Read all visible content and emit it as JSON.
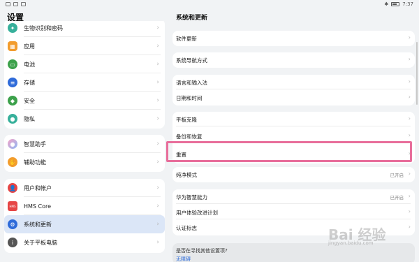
{
  "status_bar": {
    "time": "7:37"
  },
  "left": {
    "title": "设置",
    "items": [
      {
        "label": "生物识别和密码",
        "icon": "fingerprint-icon",
        "color": "#37b09b"
      },
      {
        "label": "应用",
        "icon": "apps-icon",
        "color": "#f29c2d"
      },
      {
        "label": "电池",
        "icon": "battery-icon",
        "color": "#3ca14b"
      },
      {
        "label": "存储",
        "icon": "storage-icon",
        "color": "#2f6bd9"
      },
      {
        "label": "安全",
        "icon": "shield-icon",
        "color": "#3ca14b"
      },
      {
        "label": "隐私",
        "icon": "privacy-icon",
        "color": "#37b09b"
      },
      {
        "label": "智慧助手",
        "icon": "assistant-icon",
        "color": "#c18bd8"
      },
      {
        "label": "辅助功能",
        "icon": "accessibility-icon",
        "color": "#f29c2d"
      },
      {
        "label": "用户和帐户",
        "icon": "user-icon",
        "color": "#e64545"
      },
      {
        "label": "HMS Core",
        "icon": "hms-icon",
        "color": "#e64545"
      },
      {
        "label": "系统和更新",
        "icon": "system-icon",
        "color": "#2f6bd9"
      },
      {
        "label": "关于平板电脑",
        "icon": "info-icon",
        "color": "#555555"
      }
    ]
  },
  "right": {
    "title": "系统和更新",
    "items": [
      {
        "label": "软件更新"
      },
      {
        "label": "系统导航方式"
      },
      {
        "label": "语言和输入法"
      },
      {
        "label": "日期和时间"
      },
      {
        "label": "平板克隆"
      },
      {
        "label": "备份和恢复"
      },
      {
        "label": "重置"
      },
      {
        "label": "纯净模式",
        "value": "已开启"
      },
      {
        "label": "华为智慧能力",
        "value": "已开启"
      },
      {
        "label": "用户体验改进计划"
      },
      {
        "label": "认证标志"
      }
    ],
    "search_card": {
      "question": "是否在寻找其他设置项?",
      "link": "无障碍"
    }
  },
  "watermark": {
    "text": "Bai 经验",
    "sub": "jingyan.baidu.com"
  },
  "colors": {
    "highlight": "#e86e9b",
    "selected": "#dbe6f7",
    "link": "#2a6ad9"
  }
}
